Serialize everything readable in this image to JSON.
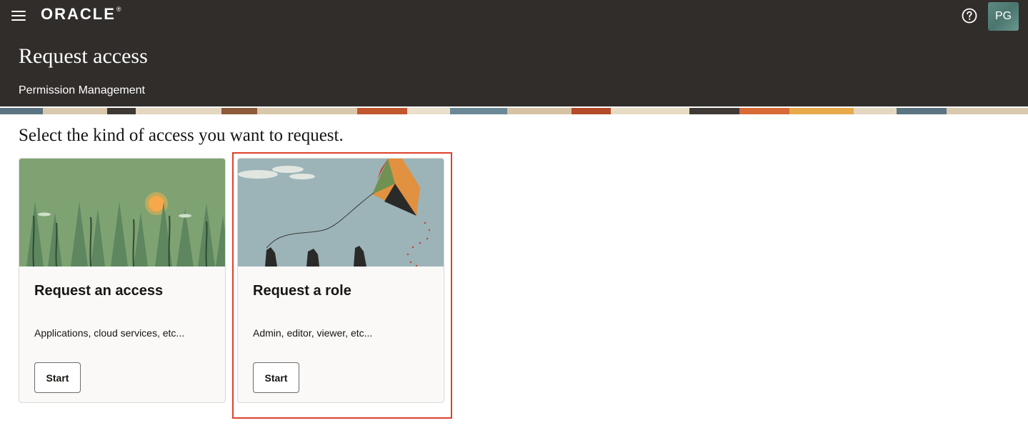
{
  "header": {
    "logo_text": "ORACLE",
    "page_title": "Request access",
    "subtitle": "Permission Management",
    "avatar_initials": "PG"
  },
  "main": {
    "instructions": "Select the kind of access you want to request.",
    "cards": [
      {
        "title": "Request an access",
        "description": "Applications, cloud services, etc...",
        "button_label": "Start",
        "illustration": "forest-sun-illustration"
      },
      {
        "title": "Request a role",
        "description": "Admin, editor, viewer, etc...",
        "button_label": "Start",
        "illustration": "kite-hands-illustration"
      }
    ]
  },
  "icons": {
    "menu": "hamburger-menu-icon",
    "help": "help-question-icon"
  },
  "colors": {
    "header_bg": "#312d2a",
    "highlight": "#e0402a",
    "card_bg": "#fbf9f8"
  }
}
